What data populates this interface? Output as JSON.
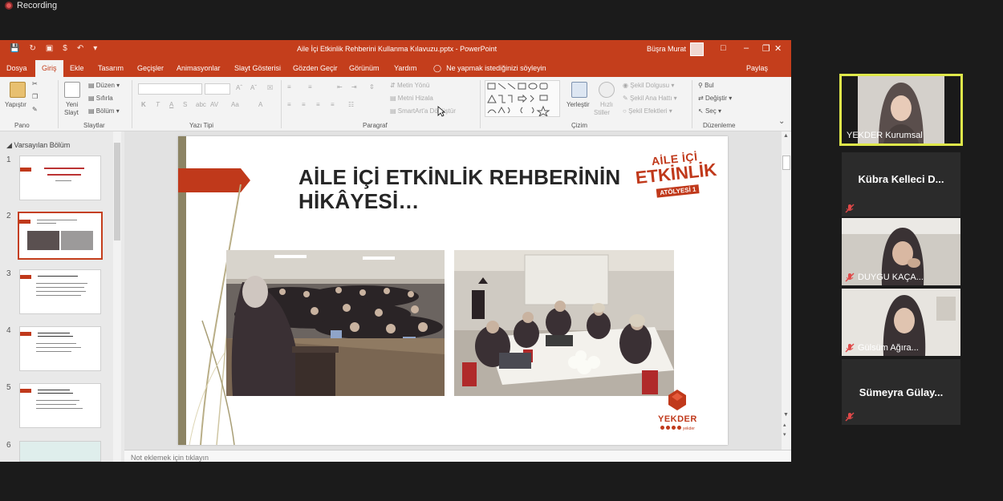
{
  "recording": {
    "label": "Recording"
  },
  "window": {
    "document_title": "Aile İçi Etkinlik Rehberini Kullanma Kılavuzu.pptx",
    "app_name": "PowerPoint",
    "separator": "-",
    "user_name": "Büşra Murat"
  },
  "tabs": [
    "Dosya",
    "Giriş",
    "Ekle",
    "Tasarım",
    "Geçişler",
    "Animasyonlar",
    "Slayt Gösterisi",
    "Gözden Geçir",
    "Görünüm",
    "Yardım"
  ],
  "active_tab": "Giriş",
  "tell_me": "Ne yapmak istediğinizi söyleyin",
  "share": "Paylaş",
  "ribbon": {
    "paste": "Yapıştır",
    "new_slide_1": "Yeni",
    "new_slide_2": "Slayt",
    "layout": "Düzen",
    "reset": "Sıfırla",
    "section": "Bölüm",
    "text_direction": "Metin Yönü",
    "align_text": "Metni Hizala",
    "smartart": "SmartArt'a Dönüştür",
    "arrange": "Yerleştir",
    "quick_styles_1": "Hızlı",
    "quick_styles_2": "Stiller",
    "shape_fill": "Şekil Dolgusu",
    "shape_outline": "Şekil Ana Hattı",
    "shape_effects": "Şekil Efektleri",
    "find": "Bul",
    "replace": "Değiştir",
    "select": "Seç",
    "groups": [
      "Pano",
      "Slaytlar",
      "Yazı Tipi",
      "Paragraf",
      "Çizim",
      "Düzenleme"
    ]
  },
  "thumbnails": {
    "section_header": "Varsayılan Bölüm",
    "numbers": [
      "1",
      "2",
      "3",
      "4",
      "5",
      "6"
    ],
    "selected": "2"
  },
  "slide": {
    "title_line1": "AİLE İÇİ ETKİNLİK REHBERİNİN",
    "title_line2": "HİKÂYESİ…",
    "logo_top_1": "AİLE İÇİ",
    "logo_top_2": "ETKİNLİK",
    "logo_top_3": "ATÖLYESİ 1",
    "logo_bottom": "YEKDER",
    "logo_bottom_sub": "yekder"
  },
  "notes_placeholder": "Not eklemek için tıklayın",
  "participants": [
    {
      "name": "YEKDER Kurumsal",
      "type": "video",
      "active": true
    },
    {
      "name": "Kübra Kelleci D...",
      "type": "name"
    },
    {
      "name": "DUYGU KAÇA...",
      "type": "video"
    },
    {
      "name": "Gülsüm Ağıra...",
      "type": "video"
    },
    {
      "name": "Sümeyra Gülay...",
      "type": "name"
    }
  ],
  "colors": {
    "accent": "#c43e1c",
    "active_speaker": "#dfe84a",
    "logo_red": "#c0391b"
  }
}
